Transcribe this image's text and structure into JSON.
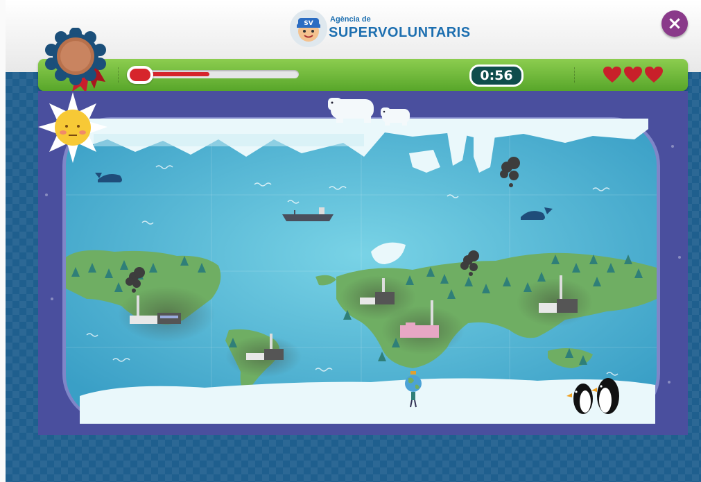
{
  "header": {
    "logo_small": "Agència de",
    "logo_big": "SUPERVOLUNTARIS",
    "logo_badge": "SV"
  },
  "close_button": {
    "icon": "close-icon",
    "label": "×"
  },
  "hud": {
    "temperature_level": 0.48,
    "timer": "0:56",
    "lives": 3,
    "medal": "bronze"
  },
  "colors": {
    "hud_green": "#6bb83a",
    "timer_bg": "#0f4d4c",
    "heart": "#c8202a",
    "ocean": "#5ec6dd",
    "land": "#6fae63",
    "frame": "#4a4f9e",
    "close": "#8a3a8a"
  },
  "icons": [
    "medal-icon",
    "thermometer-icon",
    "heart-icon",
    "sun-icon",
    "polar-bear-icon",
    "whale-icon",
    "ship-icon",
    "smoke-cloud-icon",
    "factory-icon",
    "tree-icon",
    "globe-kid-icon",
    "penguin-icon",
    "iceberg-icon"
  ]
}
